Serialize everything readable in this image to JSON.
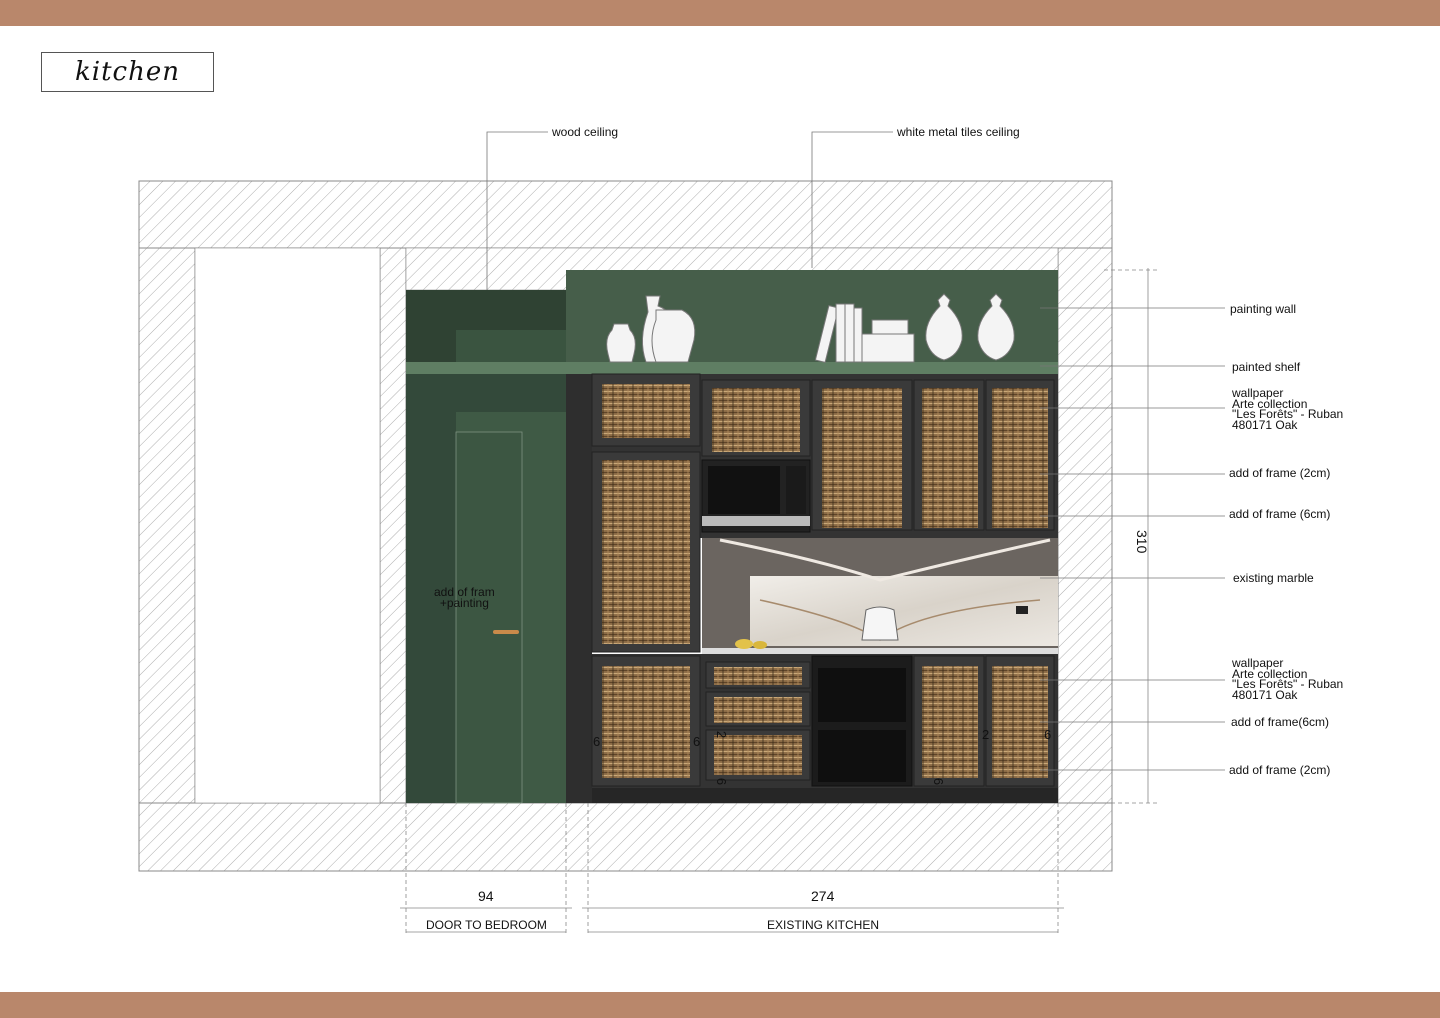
{
  "title": "kitchen",
  "colors": {
    "band": "#b9876b",
    "hatch": "#9a9a9a",
    "green_dark": "#2f4233",
    "green_mid": "#3f5a45",
    "green_wall": "#465e4a",
    "cabinet_frame": "#3a3a3a",
    "wallpaper": "#8a6a45",
    "marble": "#e8e4de"
  },
  "ceiling_labels": {
    "wood": "wood ceiling",
    "metal": "white metal tiles ceiling"
  },
  "right_labels": {
    "painting_wall": "painting wall",
    "painted_shelf": "painted shelf",
    "wallpaper_top": [
      "wallpaper",
      "Arte collection",
      "\"Les Forêts\" - Ruban",
      "480171 Oak"
    ],
    "frame_2cm_top": "add of frame (2cm)",
    "frame_6cm_top": "add of frame (6cm)",
    "marble": "existing marble",
    "wallpaper_bottom": [
      "wallpaper",
      "Arte collection",
      "\"Les Forêts\" - Ruban",
      "480171 Oak"
    ],
    "frame_6cm_bottom": "add of frame(6cm)",
    "frame_2cm_bottom": "add of frame (2cm)"
  },
  "door_note": [
    "add of fram",
    "+painting"
  ],
  "dimensions": {
    "height": "310",
    "width_door": "94",
    "width_kitchen": "274",
    "label_door": "DOOR TO BEDROOM",
    "label_kitchen": "EXISTING KITCHEN"
  },
  "frame_marks": [
    "6",
    "6",
    "2",
    "6",
    "2",
    "6",
    "6"
  ]
}
